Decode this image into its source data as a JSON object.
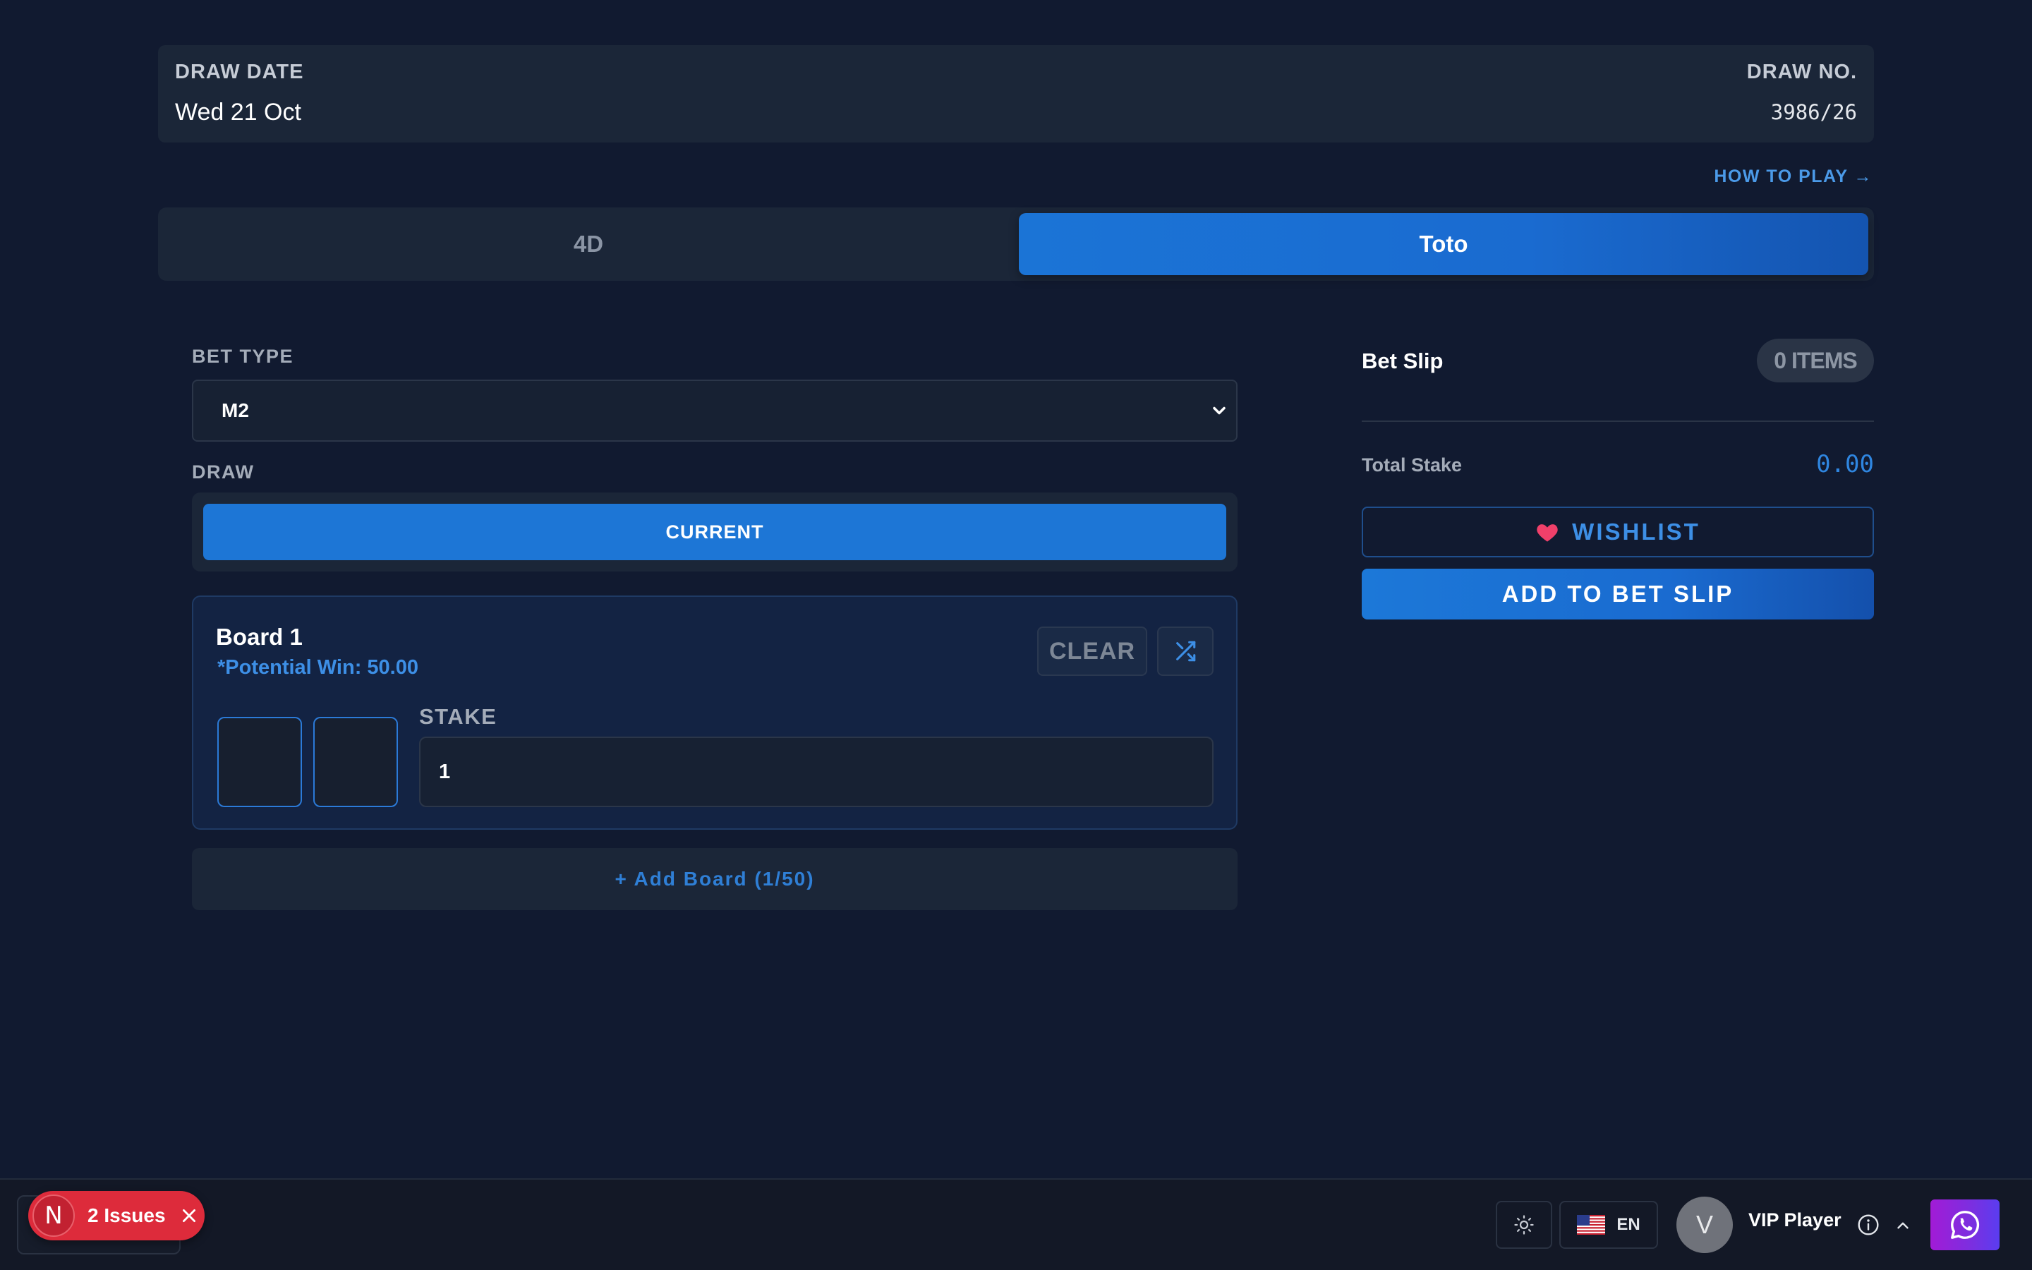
{
  "draw_info": {
    "date_label": "DRAW DATE",
    "date_value": "Wed 21 Oct",
    "number_label": "DRAW NO.",
    "number_value": "3986/26"
  },
  "how_to_play": "HOW TO PLAY →",
  "game_tabs": [
    {
      "label": "4D",
      "active": false
    },
    {
      "label": "Toto",
      "active": true
    }
  ],
  "bet_type": {
    "label": "BET TYPE",
    "selected": "M2"
  },
  "draw": {
    "label": "DRAW",
    "option": "CURRENT"
  },
  "board": {
    "title": "Board 1",
    "potential_win": "*Potential Win: 50.00",
    "clear_label": "CLEAR",
    "stake_label": "STAKE",
    "stake_value": "1",
    "number_fields": [
      "",
      ""
    ]
  },
  "add_board": "+ Add Board (1/50)",
  "bet_slip": {
    "title": "Bet Slip",
    "count": "0 ITEMS",
    "total_label": "Total Stake",
    "total_value": "0.00",
    "wishlist_label": "WISHLIST",
    "add_label": "ADD TO BET SLIP"
  },
  "bottom_bar": {
    "issues_initial": "N",
    "issues_label": "2 Issues",
    "language": "EN",
    "avatar_initial": "V",
    "user_name": "VIP Player"
  },
  "icons": {
    "shuffle": "shuffle-icon",
    "chevron": "chevron-down-icon",
    "heart": "heart-icon",
    "sun": "sun-icon",
    "flag": "us-flag-icon",
    "info": "info-icon",
    "caret": "chevron-up-icon",
    "whatsapp": "whatsapp-icon",
    "close": "close-icon"
  },
  "colors": {
    "background": "#111a30",
    "panel": "#1b2638",
    "accent": "#1d76d6",
    "issues_red": "#dd2b3b",
    "whatsapp_gradient": "#a21bd6"
  }
}
